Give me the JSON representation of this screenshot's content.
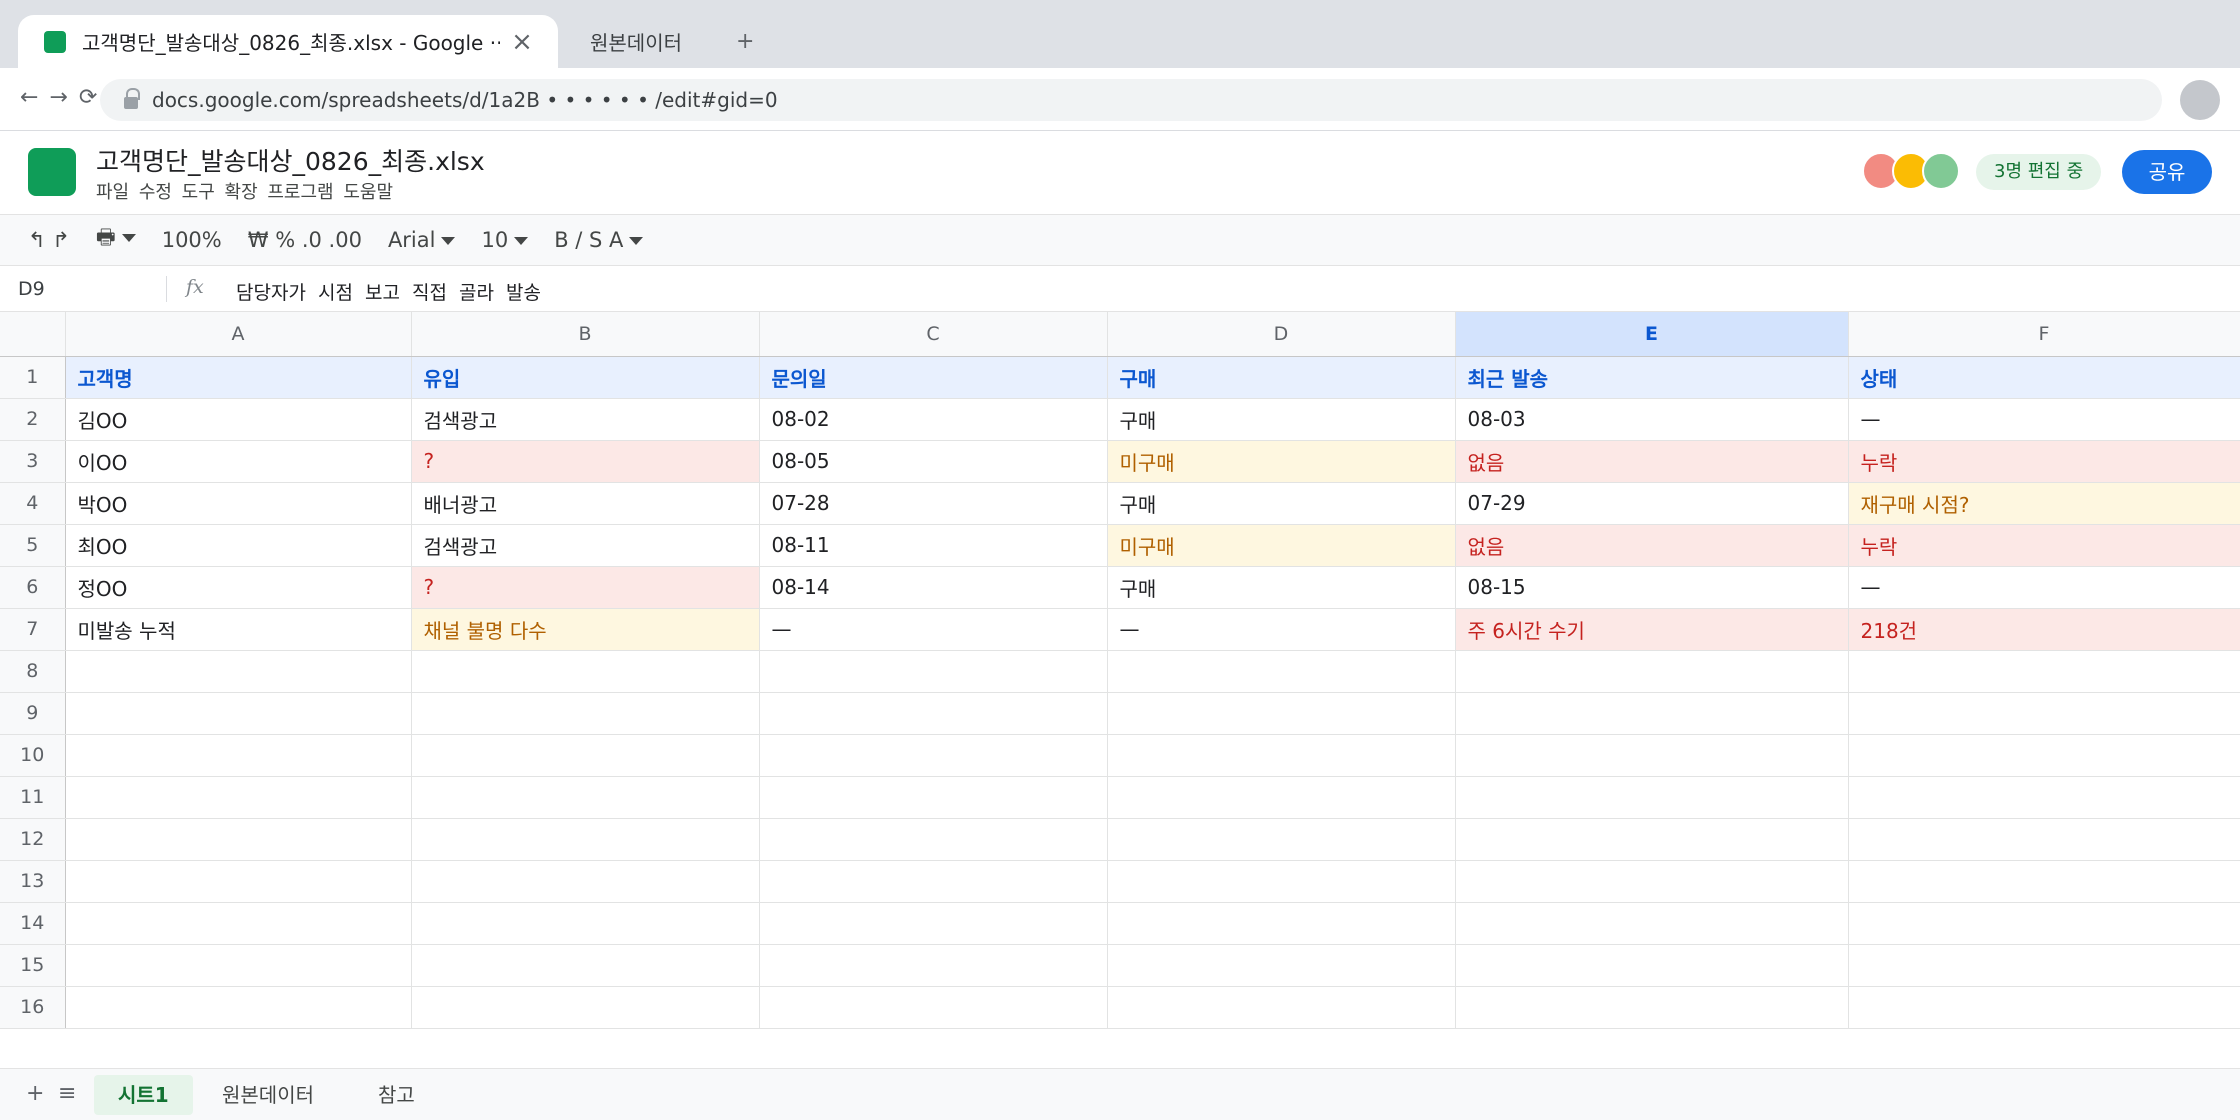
{
  "browser": {
    "active_tab_title": "고객명단_발송대상_0826_최종.xlsx - Google ···",
    "inactive_tab_title": "원본데이터",
    "new_tab": "+",
    "nav": "← → ⟳",
    "url": "docs.google.com/spreadsheets/d/1a2B • • • • • • /edit#gid=0"
  },
  "doc": {
    "title": "고객명단_발송대상_0826_최종.xlsx",
    "menus": "파일 수정 도구 확장 프로그램 도움말",
    "editing_badge": "3명 편집 중",
    "share_label": "공유"
  },
  "toolbar": {
    "undo_redo": "↰ ↱",
    "print": "🖶",
    "zoom": "100%",
    "number_format": "₩ % .0 .00",
    "font": "Arial",
    "font_size": "10",
    "text_style": "B / S A"
  },
  "formula_bar": {
    "cell_ref": "D9",
    "fx": "fx",
    "content": "담당자가 시점 보고 직접 골라 발송"
  },
  "grid": {
    "selected_column": "E",
    "columns": [
      "A",
      "B",
      "C",
      "D",
      "E",
      "F"
    ],
    "rows": [
      {
        "n": "1",
        "cells": [
          "고객명",
          "유입",
          "문의일",
          "구매",
          "최근 발송",
          "상태"
        ]
      },
      {
        "n": "2",
        "cells": [
          "김OO",
          "검색광고",
          "08-02",
          "구매",
          "08-03",
          "—"
        ]
      },
      {
        "n": "3",
        "cells": [
          "이OO",
          "?",
          "08-05",
          "미구매",
          "없음",
          "누락"
        ]
      },
      {
        "n": "4",
        "cells": [
          "박OO",
          "배너광고",
          "07-28",
          "구매",
          "07-29",
          "재구매 시점?"
        ]
      },
      {
        "n": "5",
        "cells": [
          "최OO",
          "검색광고",
          "08-11",
          "미구매",
          "없음",
          "누락"
        ]
      },
      {
        "n": "6",
        "cells": [
          "정OO",
          "?",
          "08-14",
          "구매",
          "08-15",
          "—"
        ]
      },
      {
        "n": "7",
        "cells": [
          "미발송 누적",
          "채널 불명 다수",
          "—",
          "—",
          "주 6시간 수기",
          "218건"
        ]
      },
      {
        "n": "8",
        "cells": [
          "",
          "",
          "",
          "",
          "",
          ""
        ]
      },
      {
        "n": "9",
        "cells": [
          "",
          "",
          "",
          "",
          "",
          ""
        ]
      },
      {
        "n": "10",
        "cells": [
          "",
          "",
          "",
          "",
          "",
          ""
        ]
      },
      {
        "n": "11",
        "cells": [
          "",
          "",
          "",
          "",
          "",
          ""
        ]
      },
      {
        "n": "12",
        "cells": [
          "",
          "",
          "",
          "",
          "",
          ""
        ]
      },
      {
        "n": "13",
        "cells": [
          "",
          "",
          "",
          "",
          "",
          ""
        ]
      },
      {
        "n": "14",
        "cells": [
          "",
          "",
          "",
          "",
          "",
          ""
        ]
      },
      {
        "n": "15",
        "cells": [
          "",
          "",
          "",
          "",
          "",
          ""
        ]
      },
      {
        "n": "16",
        "cells": [
          "",
          "",
          "",
          "",
          "",
          ""
        ]
      }
    ]
  },
  "sheet_tabs": {
    "add": "+",
    "menu": "≡",
    "tabs": [
      "시트1",
      "원본데이터",
      "참고"
    ]
  },
  "colors": {
    "sheets_green": "#0f9d58",
    "share_blue": "#1a73e8",
    "header_fill": "#e8f0fe",
    "warning_red_fill": "#fce8e6",
    "warning_yellow_fill": "#fef7e0"
  }
}
